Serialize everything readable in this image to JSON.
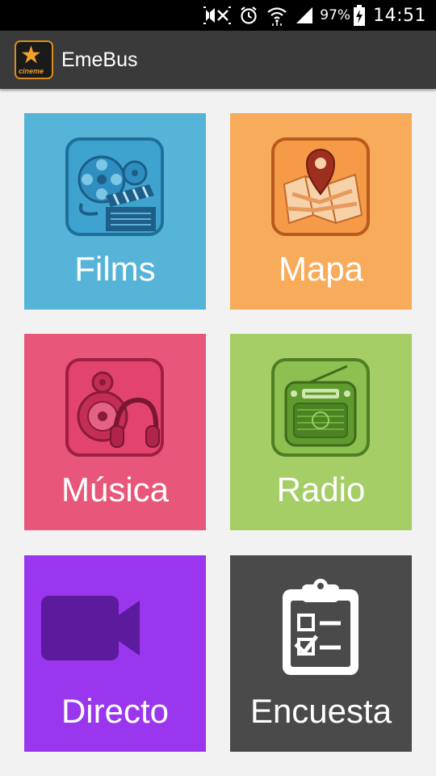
{
  "status_bar": {
    "battery": "97%",
    "time": "14:51",
    "icons": [
      "mute-icon",
      "alarm-icon",
      "wifi-icon",
      "signal-icon",
      "battery-charging-icon"
    ]
  },
  "action_bar": {
    "title": "EmeBus",
    "logo_text": "cineme",
    "logo_icon": "star-logo-icon"
  },
  "tiles": [
    {
      "label": "Films",
      "color": "#55b4d8",
      "icon": "film-reel-clapperboard-icon"
    },
    {
      "label": "Mapa",
      "color": "#f8ac5b",
      "icon": "map-pin-icon"
    },
    {
      "label": "Música",
      "color": "#e8567a",
      "icon": "speaker-headphones-icon"
    },
    {
      "label": "Radio",
      "color": "#a6ce67",
      "icon": "radio-icon"
    },
    {
      "label": "Directo",
      "color": "#9a36ee",
      "icon": "video-camera-icon"
    },
    {
      "label": "Encuesta",
      "color": "#4a4a4a",
      "icon": "clipboard-checklist-icon"
    }
  ]
}
